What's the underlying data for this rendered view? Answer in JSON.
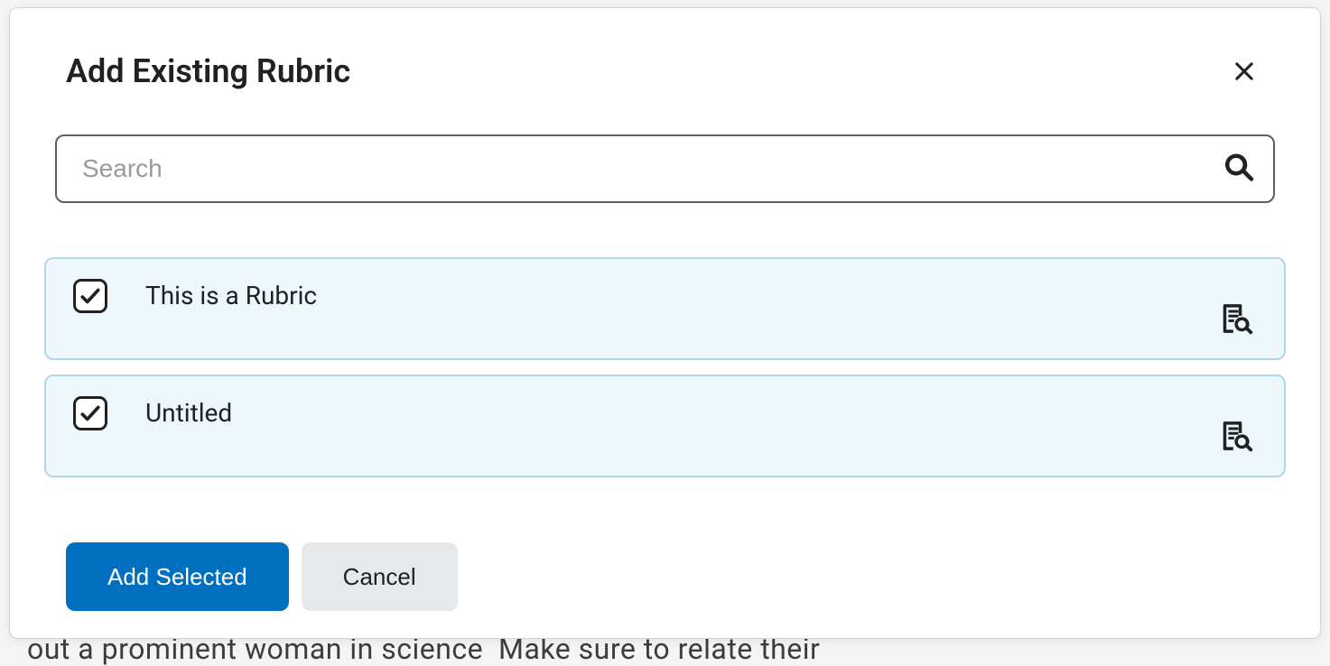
{
  "dialog": {
    "title": "Add Existing Rubric",
    "search": {
      "placeholder": "Search",
      "value": ""
    },
    "items": [
      {
        "label": "This is a Rubric",
        "checked": true
      },
      {
        "label": "Untitled",
        "checked": true
      }
    ],
    "buttons": {
      "primary": "Add Selected",
      "secondary": "Cancel"
    }
  }
}
